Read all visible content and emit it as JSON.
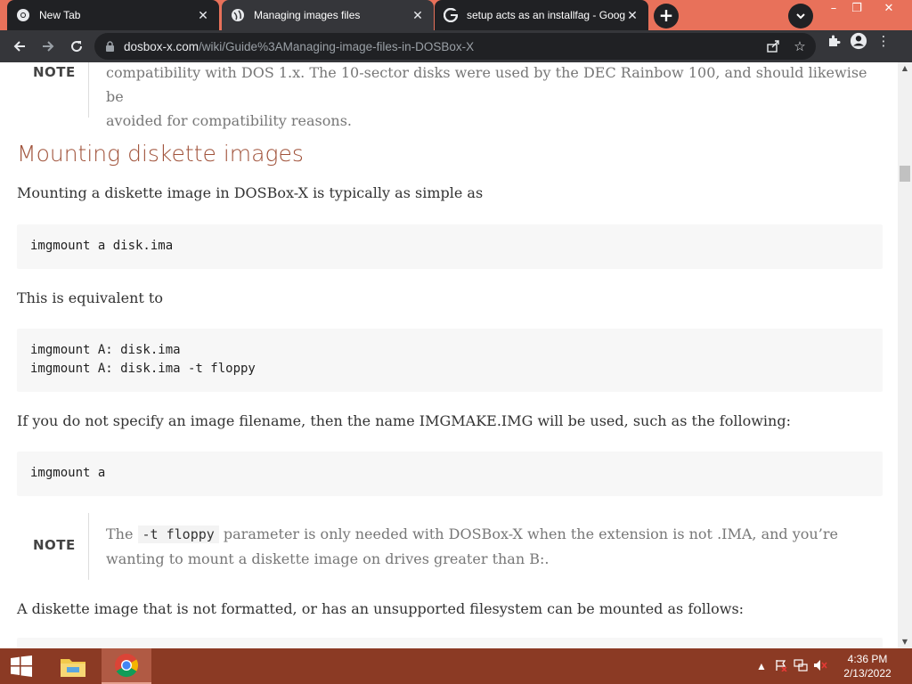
{
  "browser": {
    "tabs": [
      {
        "label": "New Tab",
        "icon": "chrome-icon",
        "active": false
      },
      {
        "label": "Managing images files",
        "icon": "globe-icon",
        "active": true
      },
      {
        "label": "setup acts as an installfag - Goog",
        "icon": "google-icon",
        "active": false
      }
    ],
    "new_tab_symbol": "+",
    "window_controls": {
      "minimize": "–",
      "restore": "❐",
      "close": "✕"
    },
    "url_host": "dosbox-x.com",
    "url_path": "/wiki/Guide%3AManaging-image-files-in-DOSBox-X"
  },
  "page": {
    "top_note": {
      "label": "NOTE",
      "lines": [
        "compatibility with DOS 1.x. The 10-sector disks were used by the DEC Rainbow 100, and should likewise be",
        "avoided for compatibility reasons."
      ]
    },
    "heading": "Mounting diskette images",
    "para1": "Mounting a diskette image in DOSBox-X is typically as simple as",
    "code1": [
      "imgmount a disk.ima"
    ],
    "para2": "This is equivalent to",
    "code2": [
      "imgmount A: disk.ima",
      "imgmount A: disk.ima -t floppy"
    ],
    "para3": "If you do not specify an image filename, then the name IMGMAKE.IMG will be used, such as the following:",
    "code3": [
      "imgmount a"
    ],
    "note2": {
      "label": "NOTE",
      "pre": "The ",
      "code": "-t floppy",
      "post": " parameter is only needed with DOSBox-X when the extension is not .IMA, and you’re",
      "line2": "wanting to mount a diskette image on drives greater than B:."
    },
    "para4": "A diskette image that is not formatted, or has an unsupported filesystem can be mounted as follows:"
  },
  "taskbar": {
    "apps": [
      "file-explorer-icon",
      "chrome-icon"
    ],
    "time": "4:36 PM",
    "date": "2/13/2022"
  },
  "colors": {
    "tabstrip": "#e8715a",
    "heading": "#a0523a",
    "taskbar": "#8b3a24"
  }
}
